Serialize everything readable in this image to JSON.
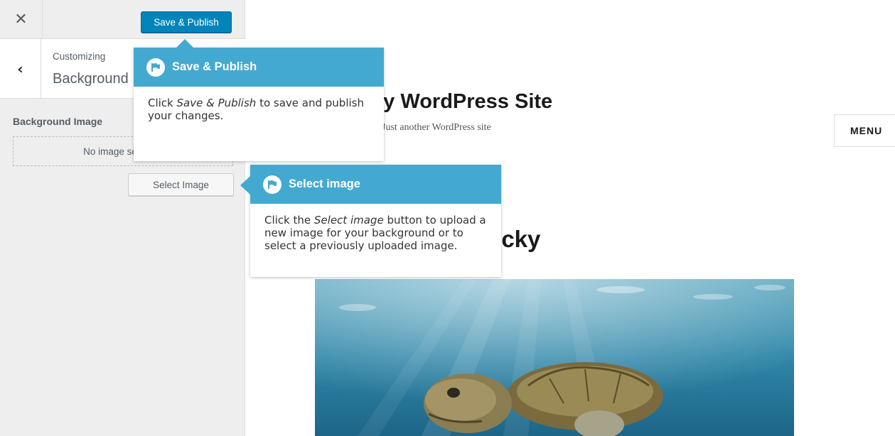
{
  "sidebar": {
    "close_symbol": "✕",
    "save_label": "Save & Publish",
    "back_symbol": "‹",
    "section_small": "Customizing",
    "section_title": "Background Image",
    "control_label": "Background Image",
    "placeholder_text": "No image selected",
    "select_label": "Select Image"
  },
  "preview": {
    "site_title": "My WordPress Site",
    "site_tagline": "Just another WordPress site",
    "menu_label": "MENU",
    "post_title": "Lucky"
  },
  "tooltips": {
    "save": {
      "title": "Save & Publish",
      "body_prefix": "Click ",
      "body_em": "Save & Publish",
      "body_suffix": " to save and publish your changes."
    },
    "select": {
      "title": "Select image",
      "body_prefix": "Click the ",
      "body_em": "Select image",
      "body_suffix": " button to upload a new image for your background or to select a previously uploaded image."
    }
  },
  "colors": {
    "accent": "#0085ba",
    "tooltip_header": "#44a9d0",
    "sidebar_bg": "#eeeeee"
  },
  "icons": {
    "close": "close-icon",
    "back": "chevron-left-icon",
    "tooltip": "flag-icon"
  }
}
